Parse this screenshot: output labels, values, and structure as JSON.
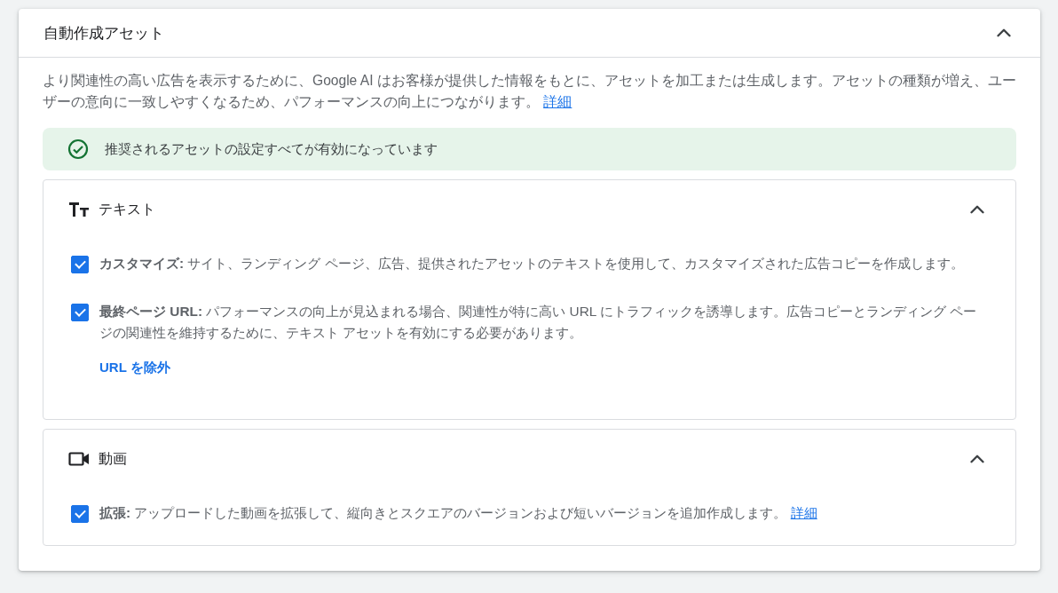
{
  "panel": {
    "title": "自動作成アセット",
    "expanded": true,
    "description": {
      "text": "より関連性の高い広告を表示するために、Google AI はお客様が提供した情報をもとに、アセットを加工または生成します。アセットの種類が増え、ユーザーの意向に一致しやすくなるため、パフォーマンスの向上につながります。",
      "link": "詳細"
    },
    "banner": "推奨されるアセットの設定すべてが有効になっています"
  },
  "sections": [
    {
      "kind": "text",
      "title": "テキスト",
      "expanded": true,
      "options": [
        {
          "checked": true,
          "text": "**カスタマイズ:** サイト、ランディング ページ、広告、提供されたアセットのテキストを使用して、カスタマイズされた広告コピーを作成します。"
        },
        {
          "checked": true,
          "text": "**最終ページ URL:** パフォーマンスの向上が見込まれる場合、関連性が特に高い URL にトラフィックを誘導します。広告コピーとランディング ページの関連性を維持するために、テキスト アセットを有効にする必要があります。",
          "action": "URL を除外"
        }
      ]
    },
    {
      "kind": "video",
      "title": "動画",
      "expanded": true,
      "options": [
        {
          "checked": true,
          "text": "**拡張:** アップロードした動画を拡張して、縦向きとスクエアのバージョンおよび短いバージョンを追加作成します。",
          "link": "詳細"
        }
      ]
    }
  ]
}
